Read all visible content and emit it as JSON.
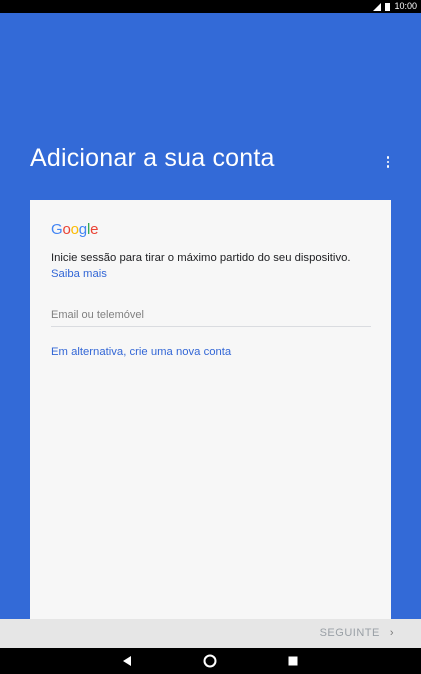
{
  "status_bar": {
    "time": "10:00"
  },
  "header": {
    "title": "Adicionar a sua conta"
  },
  "card": {
    "logo": {
      "letters": [
        "G",
        "o",
        "o",
        "g",
        "l",
        "e"
      ]
    },
    "intro_text": "Inicie sessão para tirar o máximo partido do seu dispositivo.",
    "learn_more": "Saiba mais",
    "email_placeholder": "Email ou telemóvel",
    "create_account": "Em alternativa, crie uma nova conta"
  },
  "bottom_bar": {
    "next_label": "SEGUINTE"
  },
  "nav_bar": {
    "icons": [
      "back-icon",
      "home-icon",
      "recents-icon"
    ]
  },
  "colors": {
    "accent": "#336ad7",
    "link": "#3367d6",
    "card_bg": "#f7f7f7"
  }
}
